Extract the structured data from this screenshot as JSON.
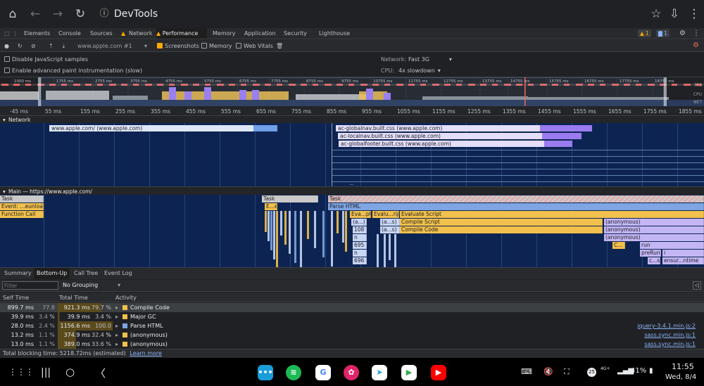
{
  "browser": {
    "title": "DevTools"
  },
  "devtools_tabs": [
    {
      "label": "Elements"
    },
    {
      "label": "Console"
    },
    {
      "label": "Sources"
    },
    {
      "label": "Network"
    },
    {
      "label": "Performance"
    },
    {
      "label": "Memory"
    },
    {
      "label": "Application"
    },
    {
      "label": "Security"
    },
    {
      "label": "Lighthouse"
    }
  ],
  "badges": {
    "warnings": "1",
    "messages": "1"
  },
  "toolbar": {
    "profile": "www.apple.com #1",
    "screenshots": "Screenshots",
    "memory": "Memory",
    "web_vitals": "Web Vitals"
  },
  "settings": {
    "disable_js": "Disable JavaScript samples",
    "paint_instr": "Enable advanced paint instrumentation (slow)",
    "network_label": "Network:",
    "network_value": "Fast 3G",
    "cpu_label": "CPU:",
    "cpu_value": "4x slowdown"
  },
  "overview": {
    "ticks": [
      "1000 ms",
      "1755 ms",
      "2755 ms",
      "3755 ms",
      "4755 ms",
      "5755 ms",
      "6755 ms",
      "7755 ms",
      "8755 ms",
      "9755 ms",
      "10755 ms",
      "11755 ms",
      "12755 ms",
      "13755 ms",
      "14755 ms",
      "15755 ms",
      "16755 ms",
      "17755 ms",
      "18755 ms"
    ],
    "fps": "FPS",
    "cpu": "CPU",
    "net": "NET"
  },
  "ruler": [
    "-45 ms",
    "55 ms",
    "155 ms",
    "255 ms",
    "355 ms",
    "455 ms",
    "555 ms",
    "655 ms",
    "755 ms",
    "855 ms",
    "955 ms",
    "1055 ms",
    "1155 ms",
    "1255 ms",
    "1355 ms",
    "1455 ms",
    "1555 ms",
    "1655 ms",
    "1755 ms",
    "1855 ms"
  ],
  "network": {
    "header": "Network",
    "requests": [
      {
        "label": "www.apple.com/ (www.apple.com)"
      },
      {
        "label": "ac-globalnav.built.css (www.apple.com)"
      },
      {
        "label": "ac-localnav.built.css (www.apple.com)"
      },
      {
        "label": "ac-globalfooter.built.css (www.apple.com)"
      }
    ],
    "more": "..."
  },
  "main": {
    "header": "Main — https://www.apple.com/",
    "flame": [
      {
        "label": "Task"
      },
      {
        "label": "Event: ...eunload"
      },
      {
        "label": "Function Call"
      },
      {
        "label": "Task"
      },
      {
        "label": "E...e"
      },
      {
        "label": "Task"
      },
      {
        "label": "Parse HTML"
      },
      {
        "label": "Eva...pt"
      },
      {
        "label": "Evalu...ript"
      },
      {
        "label": "Evaluate Script"
      },
      {
        "label": "(a...)"
      },
      {
        "label": "(a...s)"
      },
      {
        "label": "Compile Script"
      },
      {
        "label": "(anonymous)"
      },
      {
        "label": "108"
      },
      {
        "label": "(a...s)"
      },
      {
        "label": "Compile Code"
      },
      {
        "label": "(anonymous)"
      },
      {
        "label": "n"
      },
      {
        "label": "(anonymous)"
      },
      {
        "label": "695"
      },
      {
        "label": "C..."
      },
      {
        "label": "run"
      },
      {
        "label": "n"
      },
      {
        "label": "preRun"
      },
      {
        "label": "i"
      },
      {
        "label": "696"
      },
      {
        "label": "c...s"
      },
      {
        "label": "ensur...ntime"
      }
    ]
  },
  "bottom_tabs": [
    {
      "label": "Summary"
    },
    {
      "label": "Bottom-Up"
    },
    {
      "label": "Call Tree"
    },
    {
      "label": "Event Log"
    }
  ],
  "filter": {
    "placeholder": "Filter",
    "grouping": "No Grouping"
  },
  "table": {
    "headers": {
      "self": "Self Time",
      "total": "Total Time",
      "activity": "Activity"
    },
    "rows": [
      {
        "self_ms": "899.7 ms",
        "self_pct": "77.8 %",
        "total_ms": "921.3 ms",
        "total_pct": "79.7 %",
        "activity": "Compile Code",
        "color": "#f2c04c",
        "src": ""
      },
      {
        "self_ms": "39.9 ms",
        "self_pct": "3.4 %",
        "total_ms": "39.9 ms",
        "total_pct": "3.4 %",
        "activity": "Major GC",
        "color": "#f2c04c",
        "src": ""
      },
      {
        "self_ms": "28.0 ms",
        "self_pct": "2.4 %",
        "total_ms": "1156.6 ms",
        "total_pct": "100.0 %",
        "activity": "Parse HTML",
        "color": "#7fa5e3",
        "src": "jquery-3.4.1.min.js:2"
      },
      {
        "self_ms": "13.2 ms",
        "self_pct": "1.1 %",
        "total_ms": "374.9 ms",
        "total_pct": "32.4 %",
        "activity": "(anonymous)",
        "color": "#f2c04c",
        "src": "sass.sync.min.js:1"
      },
      {
        "self_ms": "13.0 ms",
        "self_pct": "1.1 %",
        "total_ms": "389.0 ms",
        "total_pct": "33.6 %",
        "activity": "(anonymous)",
        "color": "#f2c04c",
        "src": "sass.sync.min.js:1"
      }
    ]
  },
  "status": {
    "text": "Total blocking time: 5218.72ms (estimated)",
    "link": "Learn more"
  },
  "android": {
    "time": "11:55",
    "date": "Wed, 8/4",
    "battery": "41%",
    "notif": "25",
    "net": "4G+"
  }
}
